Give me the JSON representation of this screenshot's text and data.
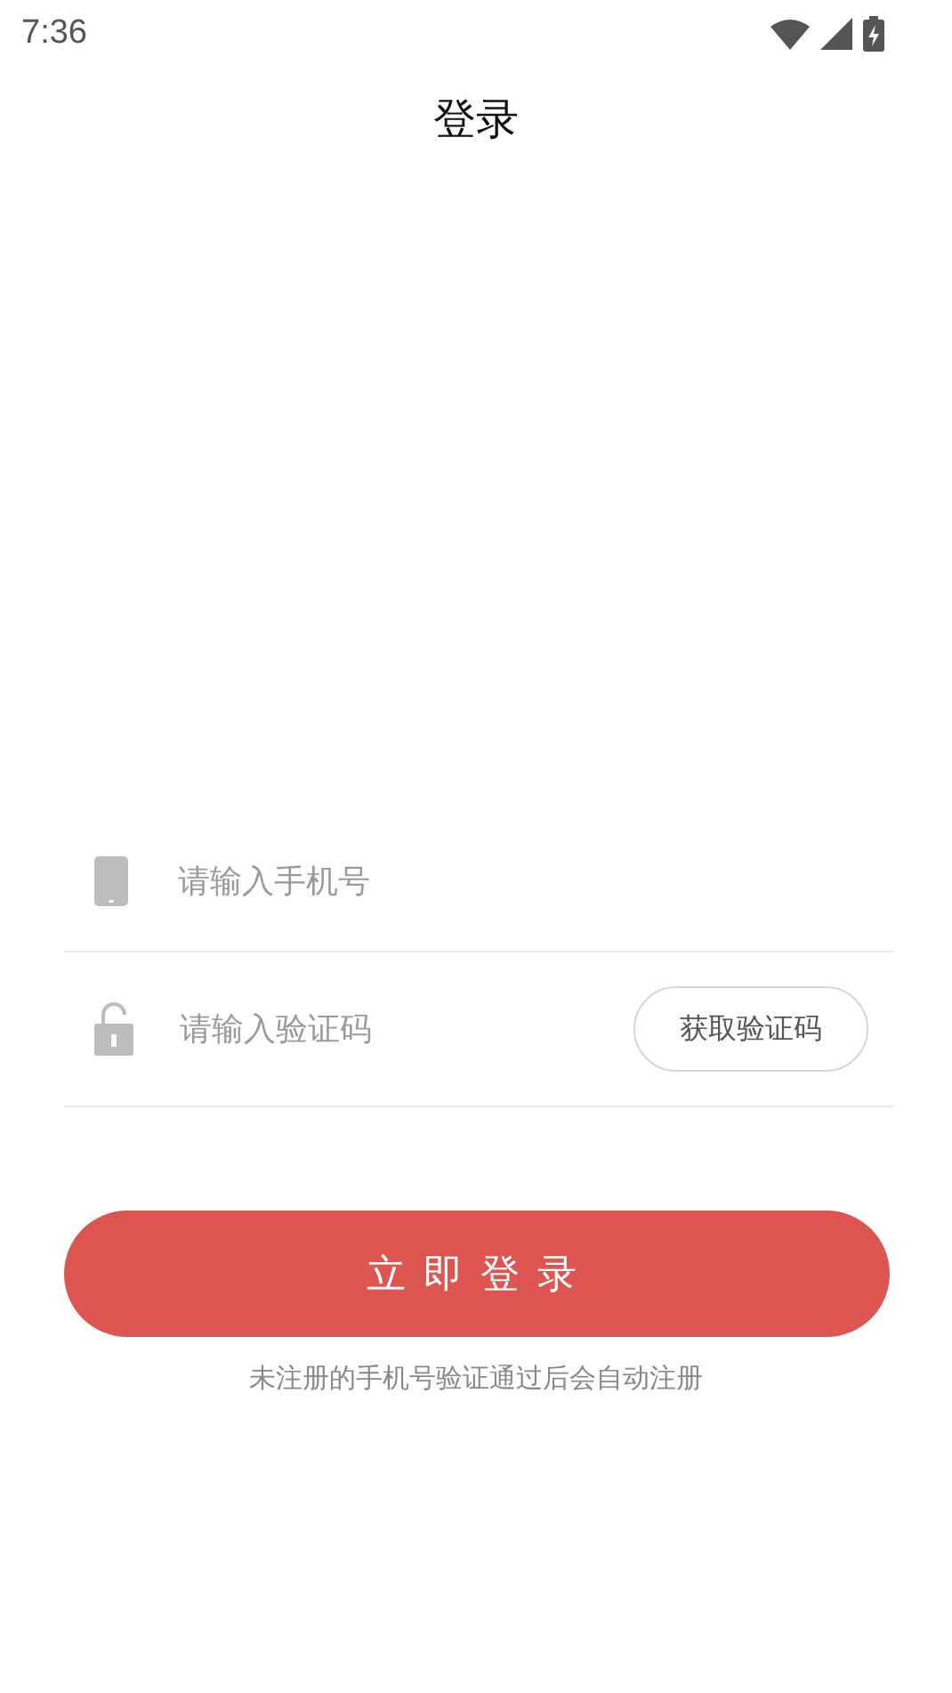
{
  "status_bar": {
    "time": "7:36"
  },
  "header": {
    "title": "登录"
  },
  "fields": [
    {
      "kind": "phone",
      "placeholder": "请输入手机号"
    },
    {
      "kind": "code",
      "placeholder": "请输入验证码",
      "action": "获取验证码"
    }
  ],
  "login_button": "立即登录",
  "note": "未注册的手机号验证通过后会自动注册"
}
